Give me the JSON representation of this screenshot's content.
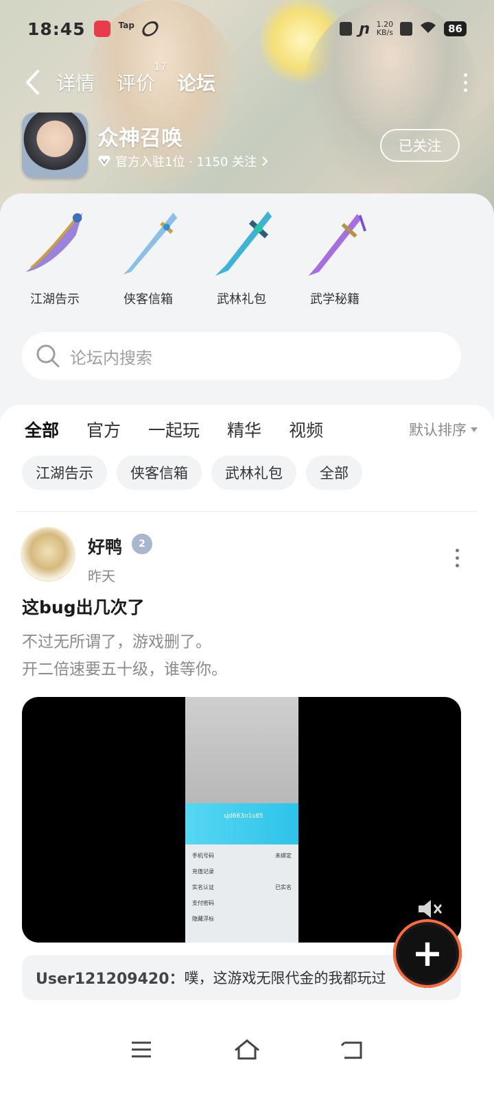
{
  "status_bar": {
    "time": "18:45",
    "speed": "1.20",
    "speed_unit": "KB/s",
    "battery": "86",
    "app_label": "Tap"
  },
  "nav": {
    "tabs": [
      {
        "label": "详情"
      },
      {
        "label": "评价",
        "count": "17"
      },
      {
        "label": "论坛"
      }
    ]
  },
  "game": {
    "name": "众神召唤",
    "subtitle": "官方入驻1位 · 1150 关注",
    "follow_label": "已关注"
  },
  "categories": [
    {
      "label": "江湖告示",
      "color": "#8b6fd6"
    },
    {
      "label": "侠客信箱",
      "color": "#8bbfe6"
    },
    {
      "label": "武林礼包",
      "color": "#3fb3d6"
    },
    {
      "label": "武学秘籍",
      "color": "#a66fe0"
    }
  ],
  "search": {
    "placeholder": "论坛内搜索"
  },
  "filters": {
    "tabs": [
      "全部",
      "官方",
      "一起玩",
      "精华",
      "视频"
    ],
    "sort_label": "默认排序"
  },
  "chips": [
    "江湖告示",
    "侠客信箱",
    "武林礼包",
    "全部"
  ],
  "post": {
    "author": "好鸭",
    "badge": "2",
    "time": "昨天",
    "title": "这bug出几次了",
    "body_lines": [
      "不过无所谓了，游戏删了。",
      "开二倍速要五十级，谁等你。"
    ],
    "video_rows": [
      {
        "label": "手机号码",
        "value": "未绑定"
      },
      {
        "label": "充值记录",
        "value": ""
      },
      {
        "label": "实名认证",
        "value": "已实名"
      },
      {
        "label": "支付密码",
        "value": ""
      },
      {
        "label": "隐藏浮标",
        "value": ""
      }
    ],
    "video_user": "sjd663n1s85"
  },
  "comment": {
    "user": "User121209420：",
    "text": "噗，这游戏无限代金的我都玩过"
  },
  "colors": {
    "accent": "#19d3b1"
  }
}
